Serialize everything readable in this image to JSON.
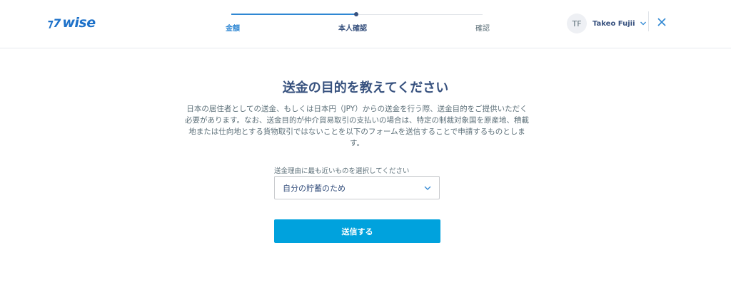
{
  "header": {
    "logo_flag": "⁊7",
    "logo_text": "wise",
    "steps": [
      {
        "label": "金額"
      },
      {
        "label": "本人確認"
      },
      {
        "label": "確認"
      }
    ],
    "user": {
      "initials": "TF",
      "name": "Takeo Fujii"
    }
  },
  "main": {
    "title": "送金の目的を教えてください",
    "description": "日本の居住者としての送金、もしくは日本円（JPY）からの送金を行う際、送金目的をご提供いただく必要があります。なお、送金目的が仲介貿易取引の支払いの場合は、特定の制裁対象国を原産地、積載地または仕向地とする貨物取引ではないことを以下のフォームを送信することで申請するものとします。",
    "select": {
      "label": "送金理由に最も近いものを選択してください",
      "value": "自分の貯蓄のため"
    },
    "submit_label": "送信する"
  },
  "colors": {
    "brand": "#1d71c9",
    "primary_button": "#00a2dd",
    "active_step": "#2f87d3",
    "text": "#37517e"
  }
}
